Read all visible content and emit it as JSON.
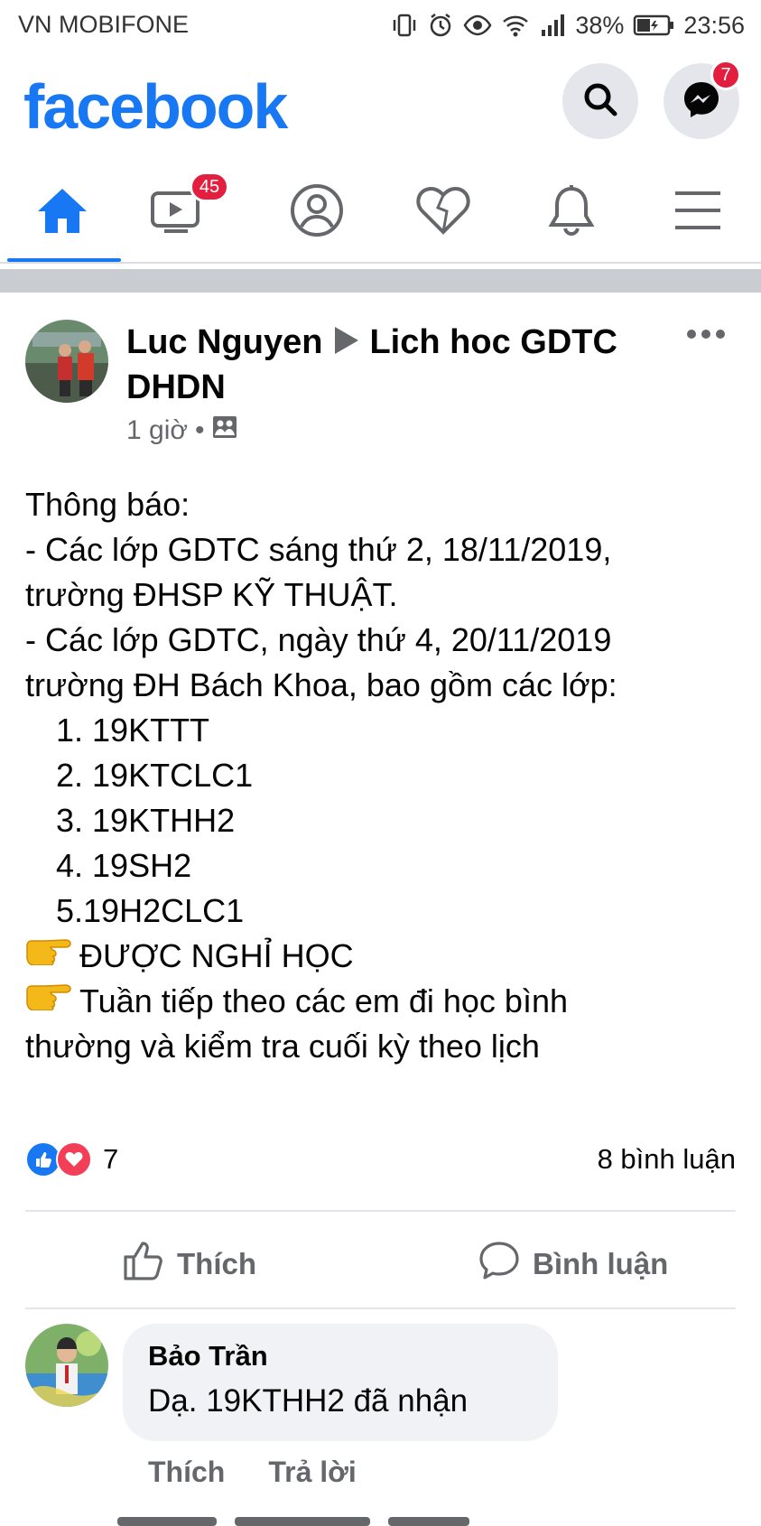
{
  "status_bar": {
    "carrier": "VN MOBIFONE",
    "battery": "38%",
    "time": "23:56"
  },
  "header": {
    "logo": "facebook",
    "search_icon": "search-icon",
    "messenger_badge": "7"
  },
  "nav": {
    "items": [
      {
        "icon": "home-icon",
        "active": true
      },
      {
        "icon": "watch-icon",
        "badge": "45"
      },
      {
        "icon": "profile-icon"
      },
      {
        "icon": "dating-heart-icon"
      },
      {
        "icon": "notifications-icon"
      },
      {
        "icon": "menu-icon"
      }
    ]
  },
  "post": {
    "author": "Luc Nguyen",
    "group": "Lich hoc GDTC DHDN",
    "time": "1 giờ",
    "privacy_icon": "group-icon",
    "lines": [
      "Thông báo:",
      "- Các lớp GDTC sáng thứ 2, 18/11/2019,",
      "trường ĐHSP KỸ THUẬT.",
      "- Các lớp GDTC, ngày thứ 4, 20/11/2019",
      "trường ĐH Bách Khoa, bao gồm các lớp:",
      "1. 19KTTT",
      "2. 19KTCLC1",
      "3. 19KTHH2",
      "4. 19SH2",
      "5.19H2CLC1",
      "ĐƯỢC NGHỈ HỌC",
      "Tuần tiếp theo các em đi học bình",
      "thường và kiểm tra cuối kỳ theo lịch"
    ],
    "reaction_count": "7",
    "comment_count": "8 bình luận",
    "like_label": "Thích",
    "comment_label": "Bình luận"
  },
  "comment": {
    "author": "Bảo Trần",
    "text": "Dạ. 19KTHH2 đã nhận",
    "like_label": "Thích",
    "reply_label": "Trả lời"
  },
  "colors": {
    "brand": "#1877f2",
    "badge": "#e41e3f",
    "love": "#f33e58",
    "secondary_text": "#65676b"
  }
}
